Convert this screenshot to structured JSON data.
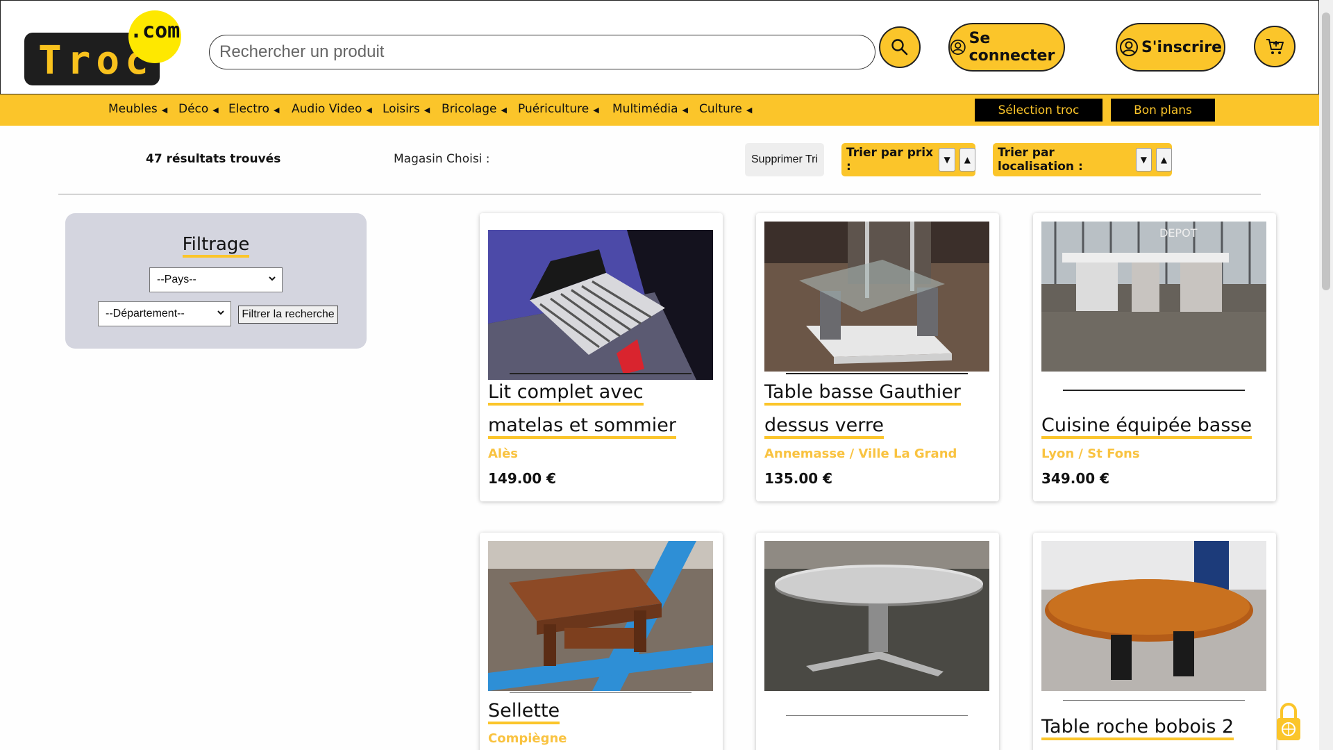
{
  "header": {
    "logo_main": "Troc",
    "logo_suffix": ".com",
    "search_placeholder": "Rechercher un produit",
    "login_label": "Se connecter",
    "signup_label": "S'inscrire"
  },
  "nav": {
    "categories": [
      "Meubles",
      "Déco",
      "Electro",
      "Audio Video",
      "Loisirs",
      "Bricolage",
      "Puériculture",
      "Multimédia",
      "Culture"
    ],
    "selection_label": "Sélection troc",
    "deals_label": "Bon plans"
  },
  "results": {
    "count_text": "47 résultats trouvés",
    "shop_label": "Magasin Choisi :",
    "clear_sort": "Supprimer Tri",
    "sort_price": "Trier par prix :",
    "sort_location": "Trier par localisation :"
  },
  "filter": {
    "title": "Filtrage",
    "country_selected": "--Pays--",
    "department_selected": "--Département--",
    "apply_label": "Filtrer la recherche"
  },
  "products": [
    {
      "title": "Lit complet avec matelas et sommier",
      "location": "Alès",
      "price": "149.00 €"
    },
    {
      "title": "Table basse Gauthier dessus verre",
      "location": "Annemasse / Ville La Grand",
      "price": "135.00 €"
    },
    {
      "title": "Cuisine équipée basse",
      "location": "Lyon / St Fons",
      "price": "349.00 €",
      "image_text": "DEPOT"
    },
    {
      "title": "Sellette",
      "location": "Compiègne",
      "price": ""
    },
    {
      "title": "",
      "location": "",
      "price": ""
    },
    {
      "title": "Table roche bobois 2",
      "location": "",
      "price": ""
    }
  ],
  "colors": {
    "accent": "#fbc52a",
    "location_text": "#f9c341",
    "filter_bg": "#d4d5df",
    "dark": "#1e1e1e"
  }
}
